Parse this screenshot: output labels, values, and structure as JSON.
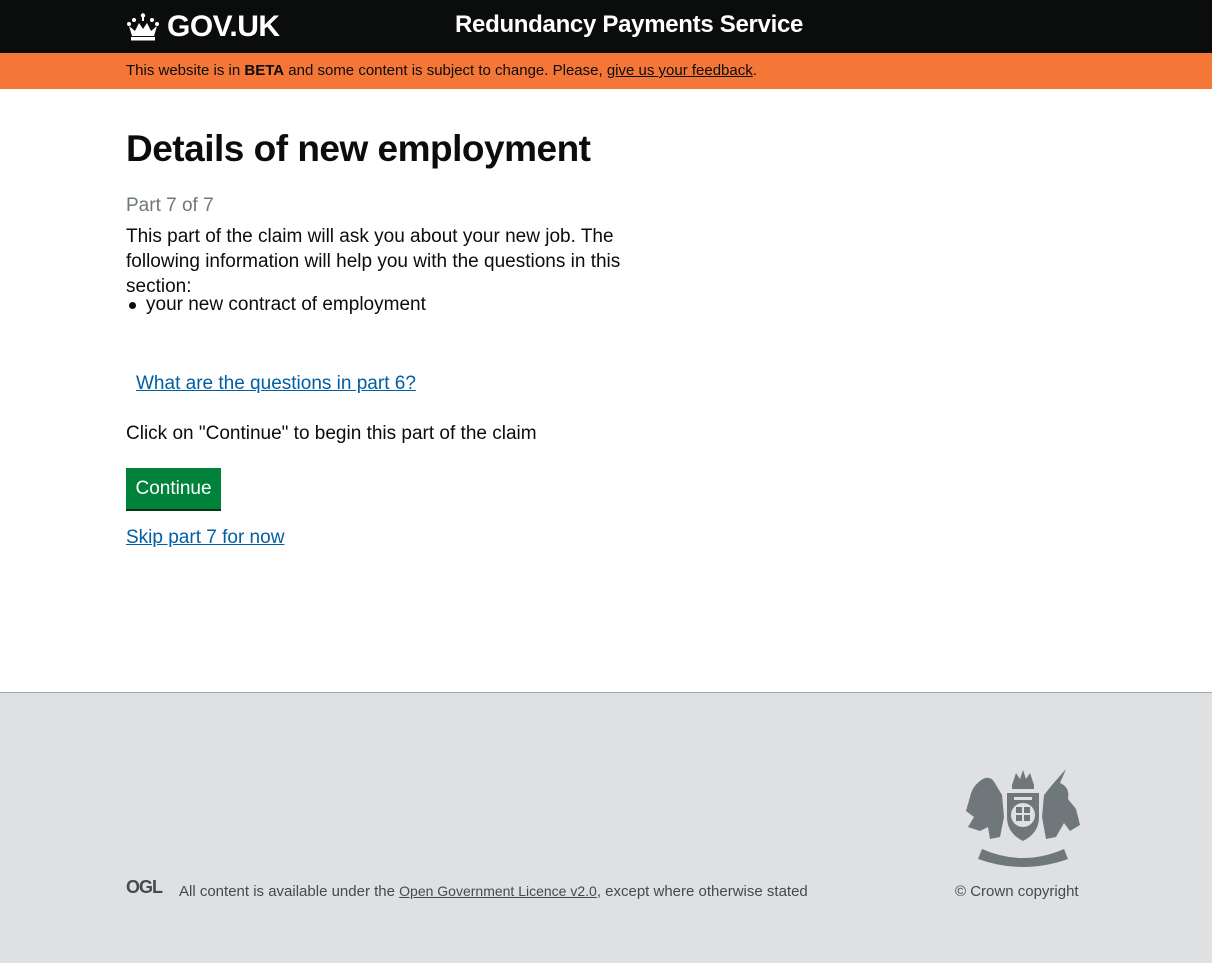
{
  "header": {
    "logo_text": "GOV.UK",
    "service_name": "Redundancy Payments Service"
  },
  "beta_banner": {
    "prefix": "This website is in ",
    "tag": "BETA",
    "middle": " and some content is subject to change. Please, ",
    "link": "give us your feedback",
    "suffix": "."
  },
  "main": {
    "title": "Details of new employment",
    "part_caption": "Part 7 of 7",
    "intro": "This part of the claim will ask you about your new job. The following information will help you with the questions in this section:",
    "bullets": [
      "your new contract of employment"
    ],
    "details_link": "What are the questions in part 6?",
    "cta_text": "Click on \"Continue\" to begin this part of the claim",
    "continue_label": "Continue",
    "skip_link": "Skip part 7 for now"
  },
  "footer": {
    "ogl_label": "OGL",
    "licence_prefix": "All content is available under the ",
    "licence_link": "Open Government Licence v2.0",
    "licence_suffix": ", except where otherwise stated",
    "copyright": "© Crown copyright"
  },
  "colors": {
    "header_bg": "#0b0c0c",
    "beta_bg": "#f47738",
    "link": "#005ea5",
    "button": "#00823b",
    "footer_bg": "#dee0e2"
  }
}
